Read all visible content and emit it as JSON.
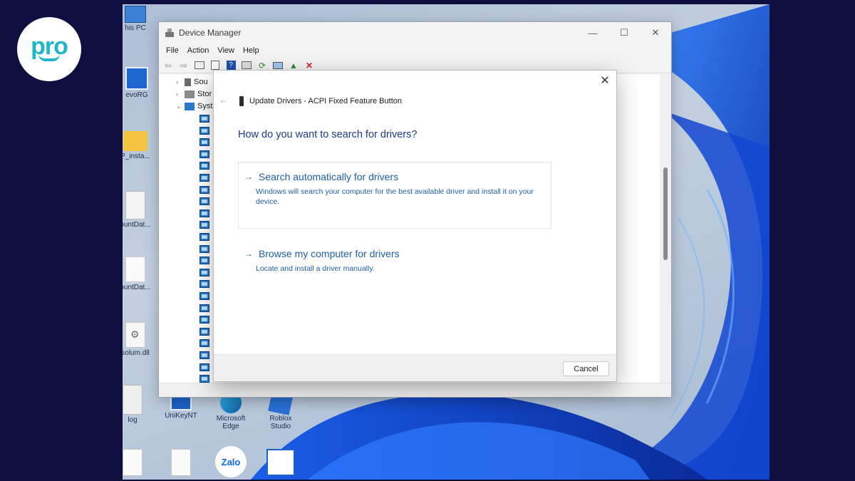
{
  "logo": {
    "text": "pro"
  },
  "desktop": {
    "icons": [
      {
        "label": "his PC"
      },
      {
        "label": "evoRG"
      },
      {
        "label": "P_insta..."
      },
      {
        "label": "ountDat..."
      },
      {
        "label": "ountDat..."
      },
      {
        "label": "solum.dll"
      },
      {
        "label": "log"
      },
      {
        "label": "UniKeyNT"
      },
      {
        "label": "Microsoft Edge"
      },
      {
        "label": "Roblox Studio"
      },
      {
        "label": "Zalo"
      }
    ]
  },
  "device_manager": {
    "title": "Device Manager",
    "menu": [
      "File",
      "Action",
      "View",
      "Help"
    ],
    "tree": [
      {
        "label": "Sou"
      },
      {
        "label": "Stor"
      },
      {
        "label": "Syst"
      }
    ]
  },
  "dialog": {
    "header": "Update Drivers - ACPI Fixed Feature Button",
    "question": "How do you want to search for drivers?",
    "options": [
      {
        "title": "Search automatically for drivers",
        "description": "Windows will search your computer for the best available driver and install it on your device."
      },
      {
        "title": "Browse my computer for drivers",
        "description": "Locate and install a driver manually."
      }
    ],
    "cancel_label": "Cancel"
  },
  "colors": {
    "accent": "#1f5fa8",
    "question": "#1e3a8a",
    "logo": "#1fb6c9",
    "frame": "#0e0f40"
  }
}
